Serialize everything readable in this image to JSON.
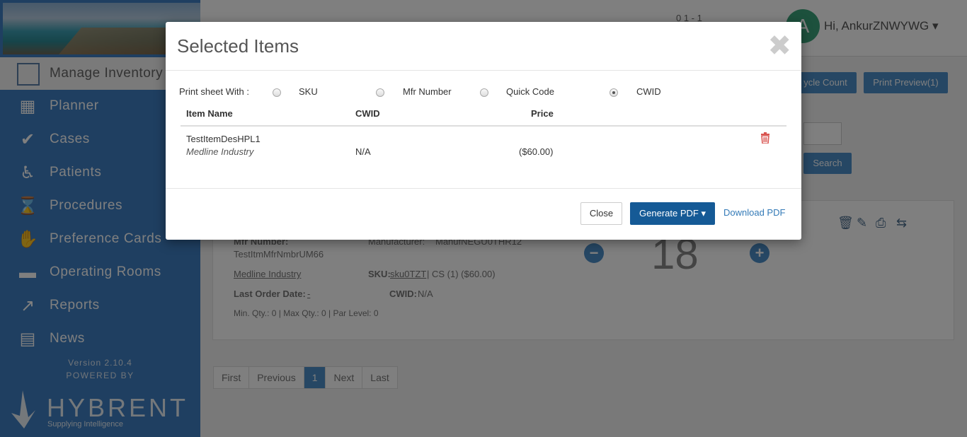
{
  "user": {
    "avatar_initial": "A",
    "greeting": "Hi, AnkurZNWYWG",
    "notifications": "0   1   -   1"
  },
  "sidebar": {
    "manage_inventory": "Manage Inventory",
    "items": [
      {
        "label": "Planner",
        "icon": "calendar-icon"
      },
      {
        "label": "Cases",
        "icon": "check-icon"
      },
      {
        "label": "Patients",
        "icon": "wheelchair-icon"
      },
      {
        "label": "Procedures",
        "icon": "hourglass-icon"
      },
      {
        "label": "Preference Cards",
        "icon": "glove-icon"
      },
      {
        "label": "Operating Rooms",
        "icon": "bed-icon"
      },
      {
        "label": "Reports",
        "icon": "line-chart-icon"
      },
      {
        "label": "News",
        "icon": "newspaper-icon"
      }
    ],
    "version": "Version 2.10.4",
    "powered_by": "POWERED BY",
    "brand": "HYBRENT",
    "tagline": "Supplying Intelligence"
  },
  "toolbar": {
    "cycle_count": "ycle Count",
    "print_preview": "Print Preview(1)",
    "search": "Search"
  },
  "card": {
    "mfr_number_label": "Mfr Number:",
    "mfr_number": "TestItmMfrNmbrUM66",
    "manufacturer_label": "Manufacturer:",
    "manufacturer": "ManufNEGU0THR12",
    "vendor": "Medline Industry",
    "sku_label": "SKU:",
    "sku": "sku0TZT",
    "cs": "| CS (1) ($60.00)",
    "last_order_label": "Last Order Date:",
    "last_order": "-",
    "cwid_label": "CWID:",
    "cwid": "N/A",
    "min_max": "Min. Qty.: 0 | Max Qty.: 0 | Par Level: 0",
    "quantity": "18"
  },
  "pagination": [
    "First",
    "Previous",
    "1",
    "Next",
    "Last"
  ],
  "modal": {
    "title": "Selected Items",
    "print_sheet_label": "Print sheet With :",
    "options": [
      "SKU",
      "Mfr Number",
      "Quick Code",
      "CWID"
    ],
    "selected_option": "CWID",
    "columns": [
      "Item Name",
      "CWID",
      "Price"
    ],
    "rows": [
      {
        "name": "TestItemDesHPL1",
        "vendor": "Medline Industry",
        "cwid": "N/A",
        "price": "($60.00)"
      }
    ],
    "close_label": "Close",
    "generate_label": "Generate PDF ▾",
    "download_label": "Download PDF"
  }
}
